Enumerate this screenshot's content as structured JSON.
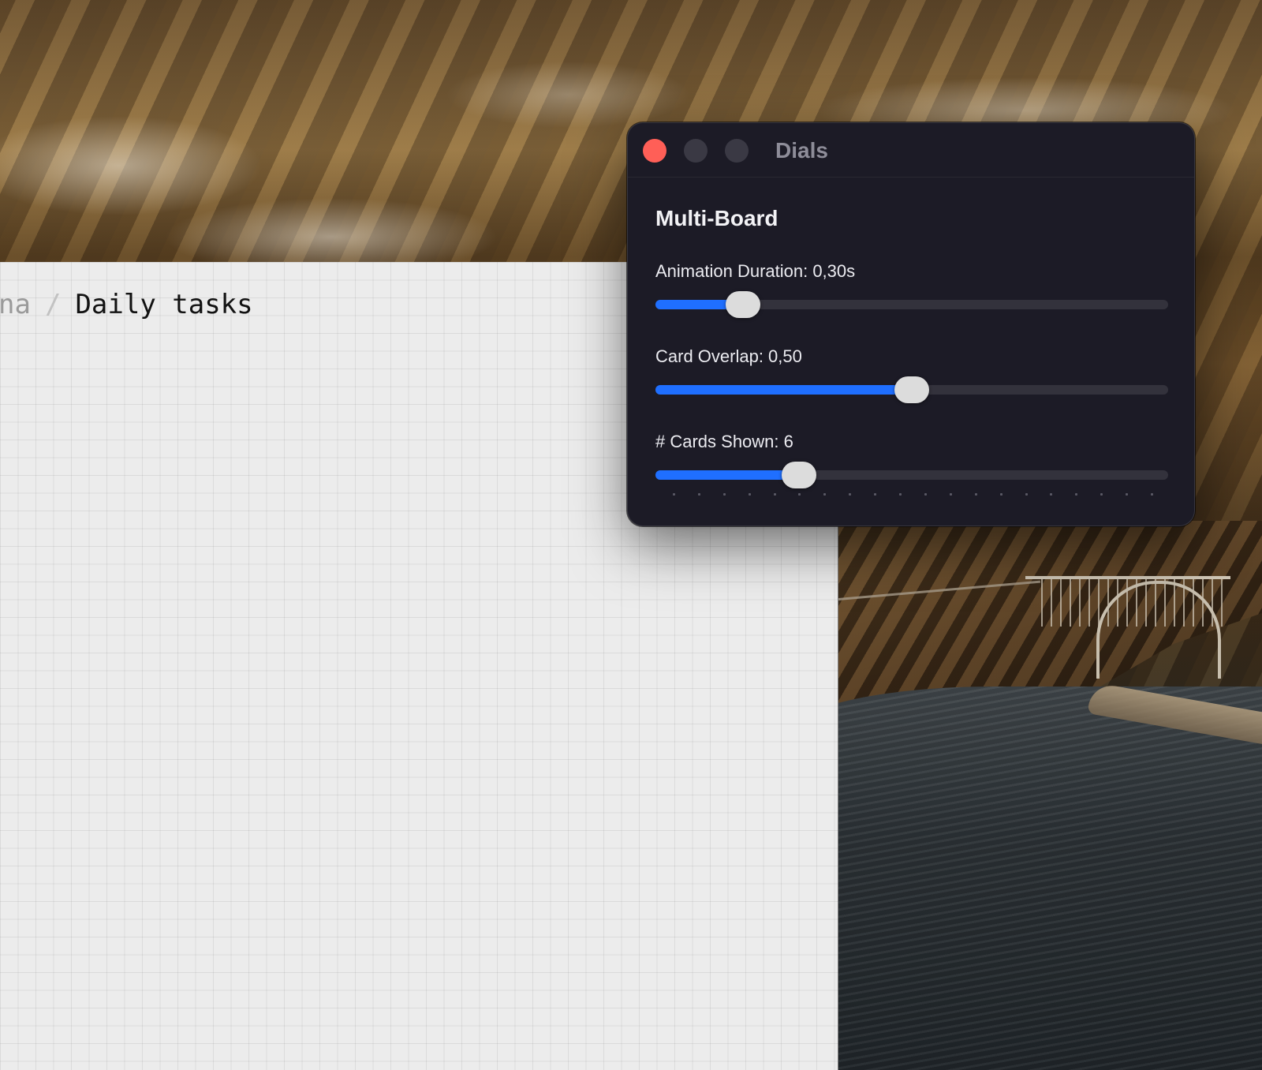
{
  "board": {
    "breadcrumb_parent": "na",
    "breadcrumb_separator": "/",
    "breadcrumb_current": "Daily tasks"
  },
  "dials": {
    "window_title": "Dials",
    "section_title": "Multi-Board",
    "sliders": [
      {
        "label": "Animation Duration: 0,30s",
        "fraction": 0.17
      },
      {
        "label": "Card Overlap: 0,50",
        "fraction": 0.5
      },
      {
        "label": "# Cards Shown: 6",
        "fraction": 0.28,
        "tick_count": 20
      }
    ]
  },
  "colors": {
    "accent": "#1f6fff",
    "close_button": "#ff5f57",
    "panel_background": "#1c1b26"
  }
}
